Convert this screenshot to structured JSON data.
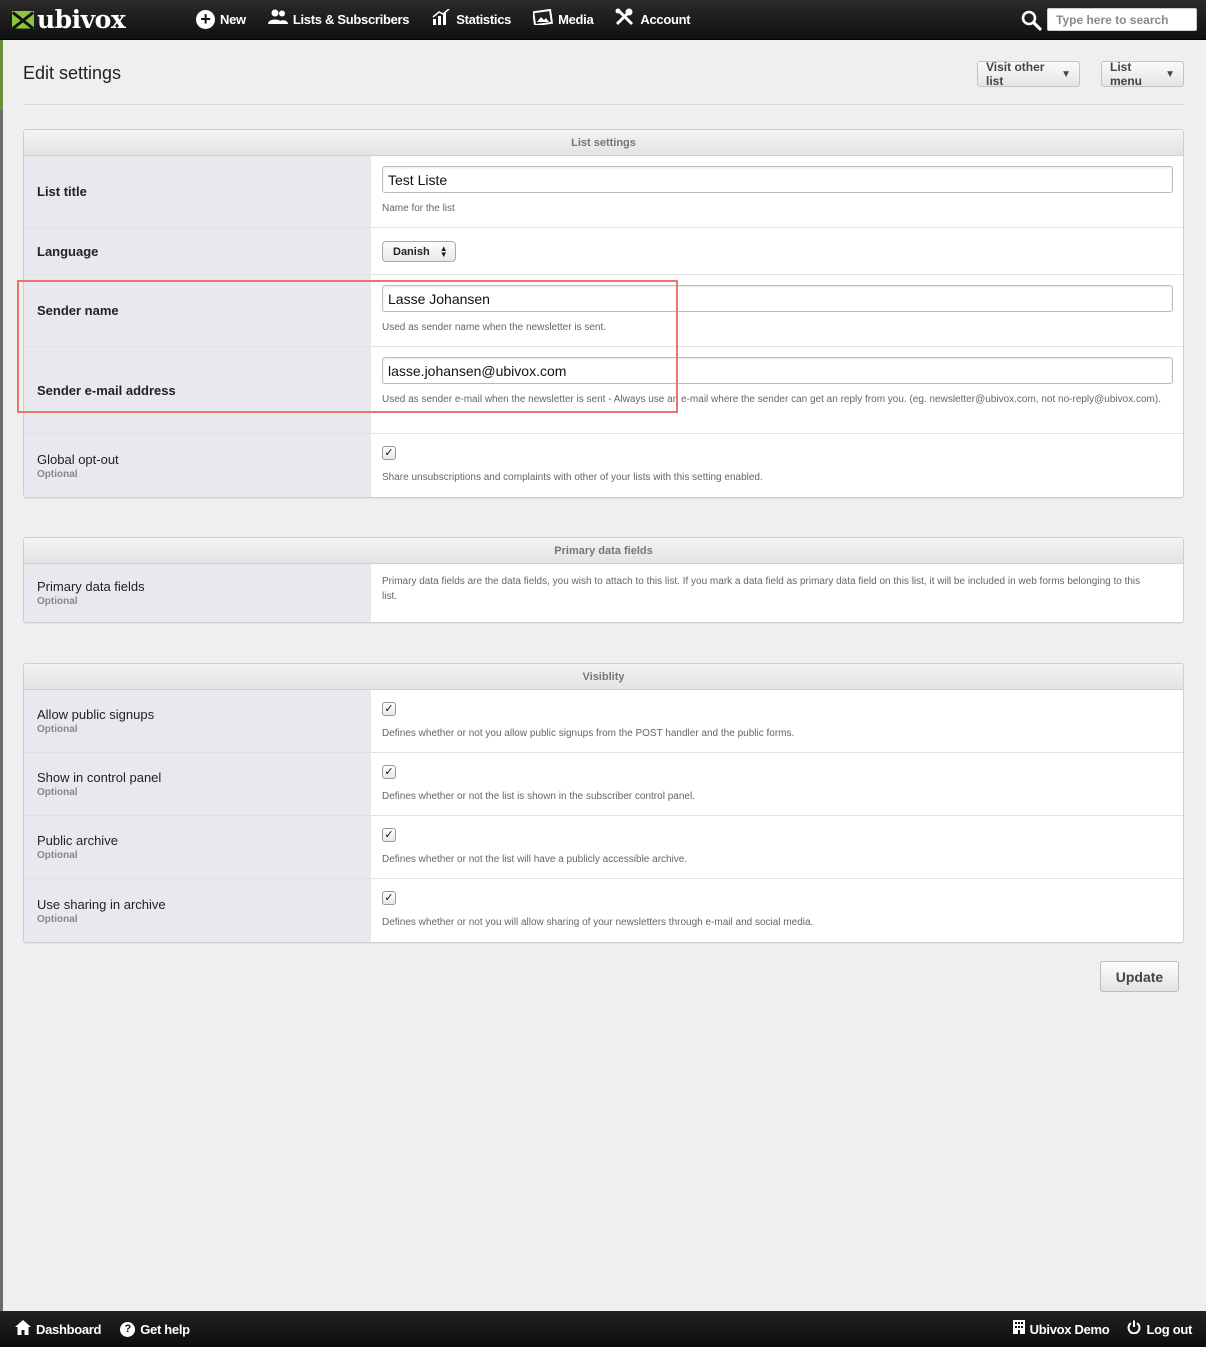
{
  "app": {
    "name": "ubivox",
    "brand_color": "#8cc63f"
  },
  "nav": {
    "items": [
      {
        "label": "New",
        "icon": "plus-circle-icon"
      },
      {
        "label": "Lists & Subscribers",
        "icon": "users-icon"
      },
      {
        "label": "Statistics",
        "icon": "bar-chart-icon"
      },
      {
        "label": "Media",
        "icon": "image-icon"
      },
      {
        "label": "Account",
        "icon": "tools-icon"
      }
    ],
    "search_placeholder": "Type here to search"
  },
  "page": {
    "title": "Edit settings",
    "visit_other_list": "Visit other list",
    "list_menu": "List menu",
    "caret": "▼"
  },
  "list_settings": {
    "header": "List settings",
    "list_title_label": "List title",
    "list_title_value": "Test Liste",
    "list_title_help": "Name for the list",
    "language_label": "Language",
    "language_value": "Danish",
    "sender_name_label": "Sender name",
    "sender_name_value": "Lasse Johansen",
    "sender_name_help": "Used as sender name when the newsletter is sent.",
    "sender_email_label": "Sender e-mail address",
    "sender_email_value": "lasse.johansen@ubivox.com",
    "sender_email_help": "Used as sender e-mail when the newsletter is sent - Always use an e-mail where the sender can get an reply from you. (eg. newsletter@ubivox.com, not no-reply@ubivox.com).",
    "global_optout_label": "Global opt-out",
    "global_optout_optional": "Optional",
    "global_optout_checked": "✓",
    "global_optout_help": "Share unsubscriptions and complaints with other of your lists with this setting enabled."
  },
  "primary_fields": {
    "header": "Primary data fields",
    "label": "Primary data fields",
    "optional": "Optional",
    "help": "Primary data fields are the data fields, you wish to attach to this list. If you mark a data field as primary data field on this list, it will be included in web forms belonging to this list."
  },
  "visibility": {
    "header": "Visiblity",
    "rows": [
      {
        "label": "Allow public signups",
        "optional": "Optional",
        "checked": "✓",
        "help": "Defines whether or not you allow public signups from the POST handler and the public forms."
      },
      {
        "label": "Show in control panel",
        "optional": "Optional",
        "checked": "✓",
        "help": "Defines whether or not the list is shown in the subscriber control panel."
      },
      {
        "label": "Public archive",
        "optional": "Optional",
        "checked": "✓",
        "help": "Defines whether or not the list will have a publicly accessible archive."
      },
      {
        "label": "Use sharing in archive",
        "optional": "Optional",
        "checked": "✓",
        "help": "Defines whether or not you will allow sharing of your newsletters through e-mail and social media."
      }
    ]
  },
  "actions": {
    "update": "Update"
  },
  "footer": {
    "dashboard": "Dashboard",
    "get_help": "Get help",
    "account_name": "Ubivox Demo",
    "logout": "Log out"
  }
}
